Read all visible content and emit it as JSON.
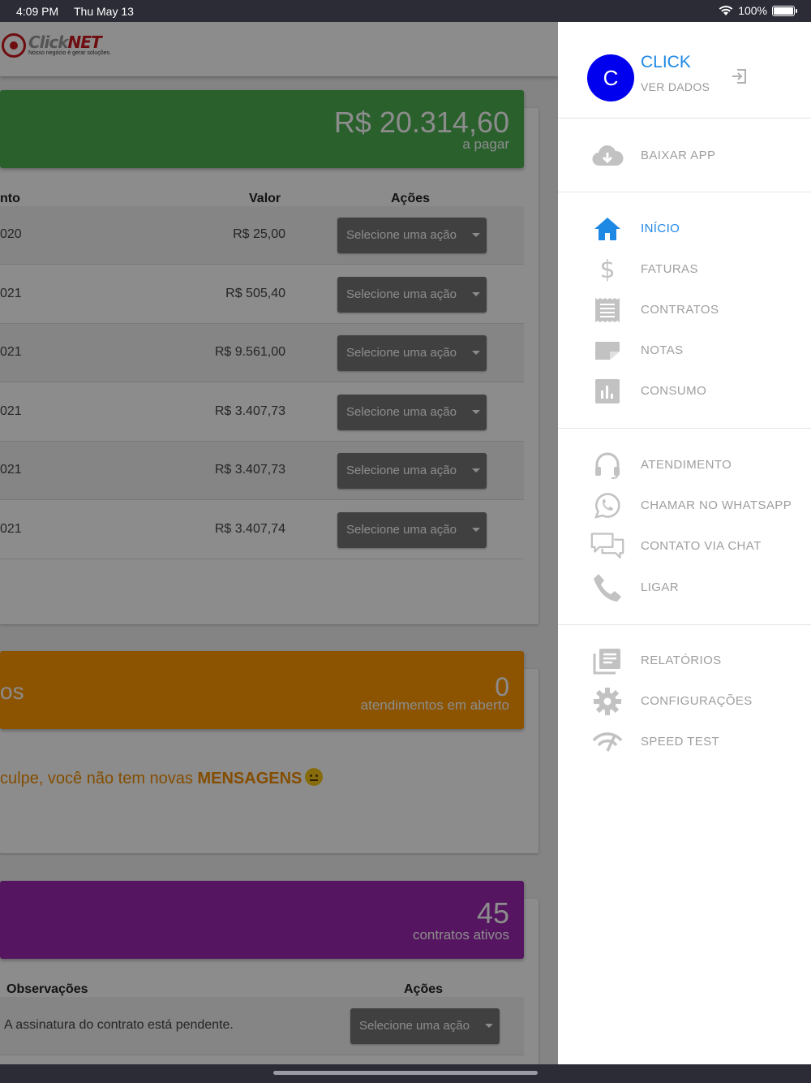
{
  "status_bar": {
    "time": "4:09 PM",
    "date": "Thu May 13",
    "battery": "100%"
  },
  "brand": {
    "name_click": "Click",
    "name_net": "NET",
    "slogan": "Nosso negócio é gerar soluções."
  },
  "faturas": {
    "total": "R$ 20.314,60",
    "total_label": "a pagar",
    "columns": {
      "vencimento": "nto",
      "valor": "Valor",
      "acoes": "Ações"
    },
    "rows": [
      {
        "date": "020",
        "value": "R$ 25,00",
        "action": "Selecione uma ação"
      },
      {
        "date": "021",
        "value": "R$ 505,40",
        "action": "Selecione uma ação"
      },
      {
        "date": "021",
        "value": "R$ 9.561,00",
        "action": "Selecione uma ação"
      },
      {
        "date": "021",
        "value": "R$ 3.407,73",
        "action": "Selecione uma ação"
      },
      {
        "date": "021",
        "value": "R$ 3.407,73",
        "action": "Selecione uma ação"
      },
      {
        "date": "021",
        "value": "R$ 3.407,74",
        "action": "Selecione uma ação"
      }
    ]
  },
  "atendimentos": {
    "title_fragment": "os",
    "count": "0",
    "count_label": "atendimentos em aberto",
    "message_start": "culpe, você não tem novas ",
    "message_bold": "MENSAGENS"
  },
  "contratos": {
    "count": "45",
    "count_label": "contratos ativos",
    "columns": {
      "observacoes": "Observações",
      "acoes": "Ações"
    },
    "rows": [
      {
        "obs": "A assinatura do contrato está pendente.",
        "action": "Selecione uma ação"
      }
    ]
  },
  "drawer": {
    "avatar_letter": "C",
    "user_name": "CLICK",
    "user_sub": "VER DADOS",
    "items": [
      {
        "label": "BAIXAR APP",
        "icon": "cloud-download-icon"
      },
      {
        "label": "INÍCIO",
        "icon": "home-icon",
        "active": true
      },
      {
        "label": "FATURAS",
        "icon": "dollar-icon"
      },
      {
        "label": "CONTRATOS",
        "icon": "receipt-icon"
      },
      {
        "label": "NOTAS",
        "icon": "note-icon"
      },
      {
        "label": "CONSUMO",
        "icon": "bar-chart-icon"
      },
      {
        "label": "ATENDIMENTO",
        "icon": "headset-icon"
      },
      {
        "label": "CHAMAR NO WHATSAPP",
        "icon": "whatsapp-icon"
      },
      {
        "label": "CONTATO VIA CHAT",
        "icon": "chat-icon"
      },
      {
        "label": "LIGAR",
        "icon": "phone-icon"
      },
      {
        "label": "RELATÓRIOS",
        "icon": "reports-icon"
      },
      {
        "label": "CONFIGURAÇÕES",
        "icon": "gear-icon"
      },
      {
        "label": "SPEED TEST",
        "icon": "speed-test-icon"
      }
    ]
  },
  "colors": {
    "green": "#4caf50",
    "orange": "#ff9800",
    "purple": "#9c27b0",
    "accent_blue": "#1e88e5",
    "avatar_blue": "#0000ee"
  }
}
